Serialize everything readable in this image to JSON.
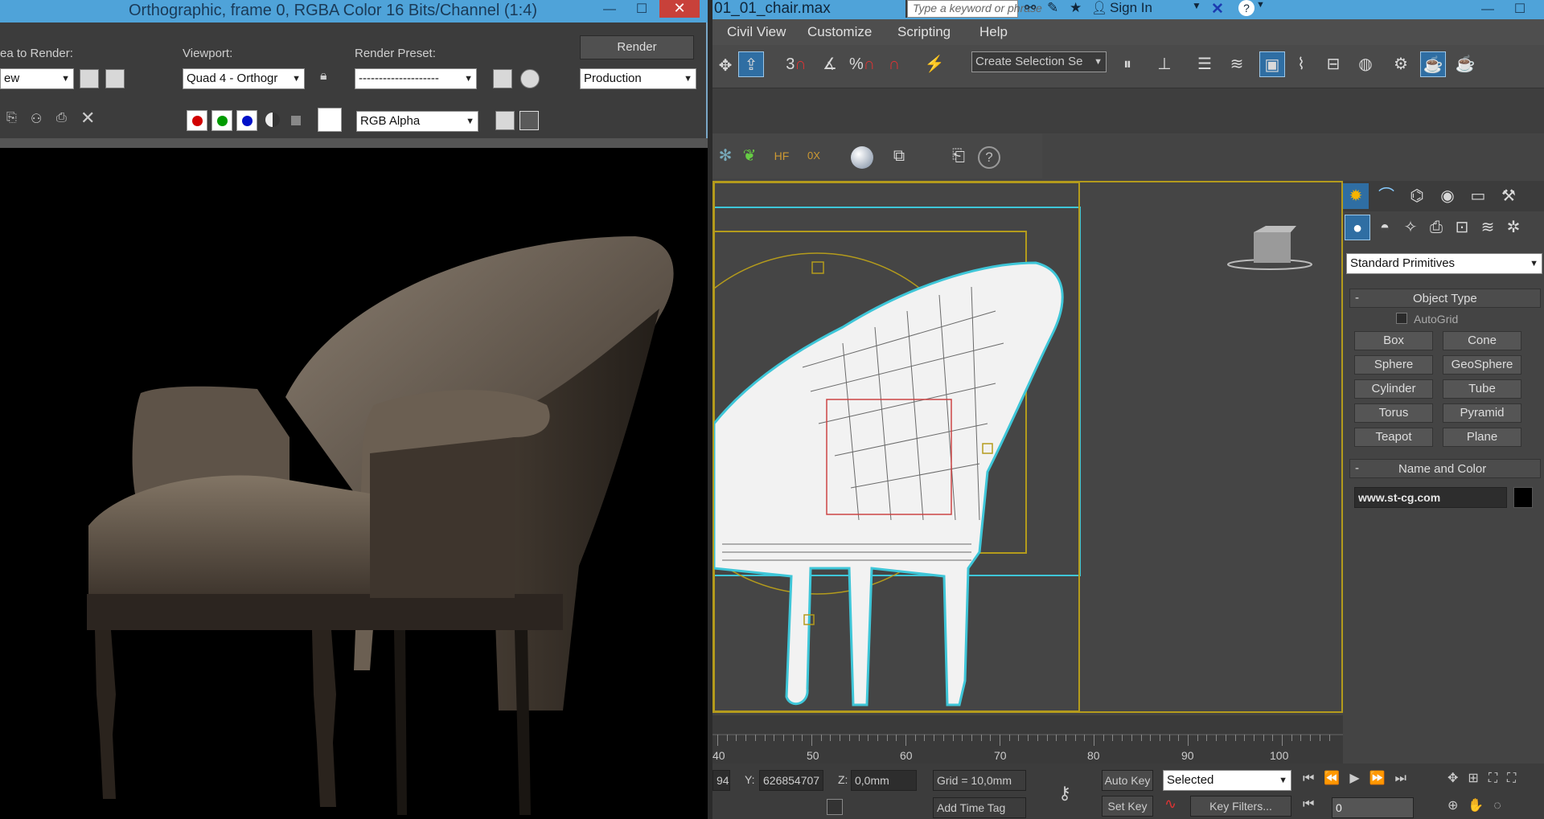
{
  "render_window": {
    "title": "Orthographic, frame 0, RGBA Color 16 Bits/Channel (1:4)",
    "minimize": "—",
    "maximize": "☐",
    "close": "✕",
    "area_label": "ea to Render:",
    "area_value": "ew",
    "viewport_label": "Viewport:",
    "viewport_value": "Quad 4 - Orthogr",
    "preset_label": "Render Preset:",
    "preset_value": "--------------------",
    "render_button": "Render",
    "production_value": "Production",
    "channel_value": "RGB Alpha"
  },
  "max_window": {
    "file_title": "01_01_chair.max",
    "search_placeholder": "Type a keyword or phrase",
    "sign_in": "Sign In",
    "menus": [
      "Civil View",
      "Customize",
      "Scripting",
      "Help"
    ],
    "selection_set": "Create Selection Se",
    "toolbar_nums": [
      "3",
      "%"
    ],
    "ribbon_hf": "HF",
    "ribbon_ox": "0X",
    "help_icon": "?"
  },
  "command_panel": {
    "category": "Standard Primitives",
    "object_type_header": "Object Type",
    "autogrid": "AutoGrid",
    "buttons": [
      "Box",
      "Cone",
      "Sphere",
      "GeoSphere",
      "Cylinder",
      "Tube",
      "Torus",
      "Pyramid",
      "Teapot",
      "Plane"
    ],
    "name_color_header": "Name and Color",
    "object_name": "www.st-cg.com",
    "collapse": "-"
  },
  "timeline": {
    "ticks": [
      "40",
      "50",
      "60",
      "70",
      "80",
      "90",
      "100"
    ]
  },
  "status": {
    "x_value": "94",
    "y_label": "Y:",
    "y_value": "626854707",
    "z_label": "Z:",
    "z_value": "0,0mm",
    "grid": "Grid = 10,0mm",
    "auto_key": "Auto Key",
    "selected": "Selected",
    "set_key": "Set Key",
    "key_filters": "Key Filters...",
    "add_time_tag": "Add Time Tag",
    "frame_value": "0"
  },
  "colors": {
    "title_bar": "#4fa3d9",
    "close_red": "#c8413a",
    "viewport_border": "#b49b1c",
    "wire_cyan": "#3ec6d8"
  }
}
